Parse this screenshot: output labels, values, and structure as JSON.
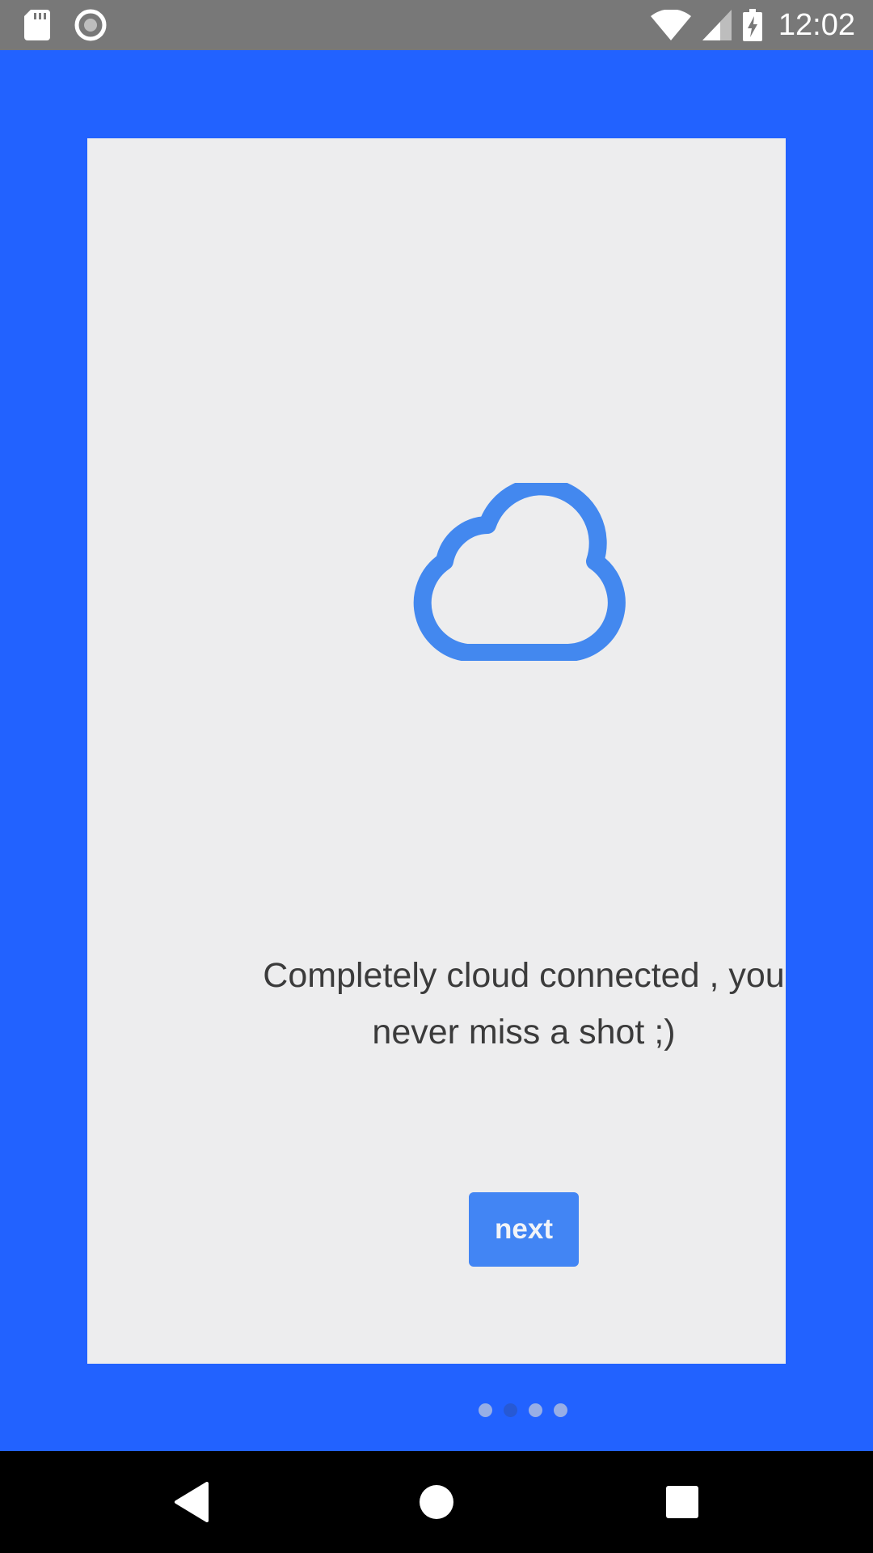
{
  "status_bar": {
    "time": "12:02",
    "left_icons": [
      "sd-card-icon",
      "record-icon"
    ],
    "right_icons": [
      "wifi-icon",
      "cell-signal-icon",
      "battery-charging-icon"
    ],
    "background": "#787878"
  },
  "onboarding": {
    "illustration_icon": "cloud-icon",
    "message": "Completely cloud connected , you never miss a shot ;)",
    "next_label": "next",
    "pager": {
      "total": 4,
      "active_index": 1
    }
  },
  "colors": {
    "screen_background": "#2262FF",
    "card_background": "#EDEDEE",
    "accent": "#4285F4",
    "dot_active": "#2759D4",
    "dot_inactive": "#97AEE6"
  },
  "nav_bar": {
    "buttons": [
      "back-icon",
      "home-icon",
      "recents-icon"
    ]
  }
}
